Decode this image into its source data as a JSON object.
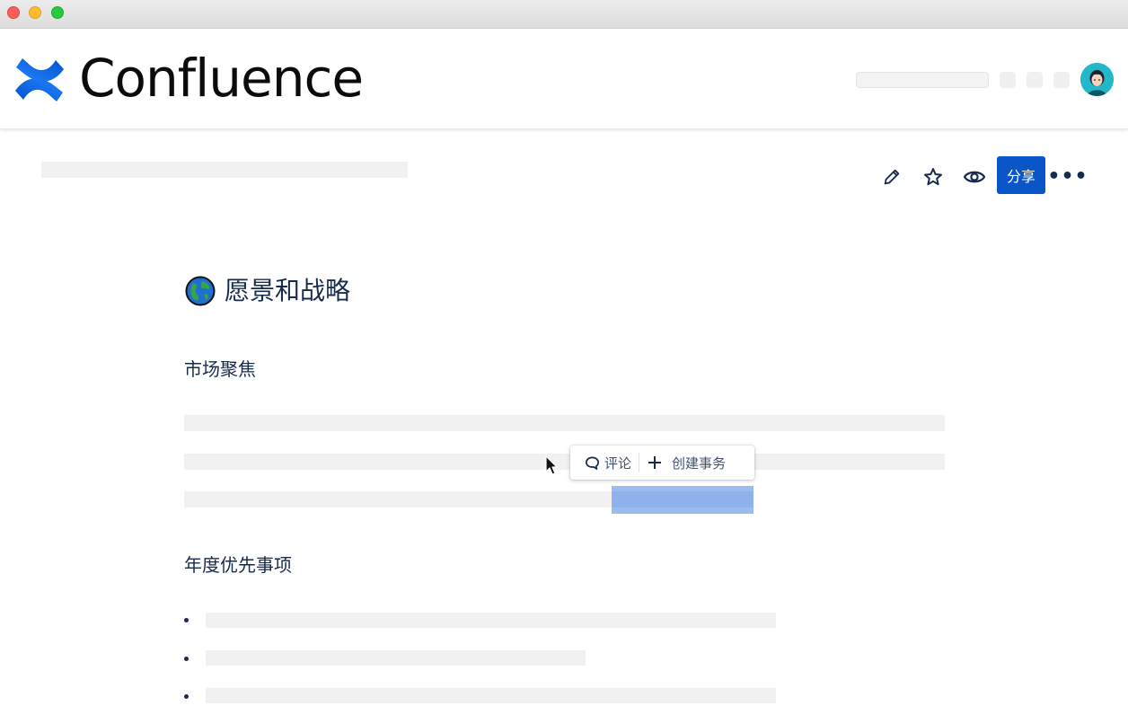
{
  "app": {
    "brand_name": "Confluence",
    "accent_color": "#0a55c7"
  },
  "header": {
    "search_placeholder": "",
    "avatar_color": "#1fb3c4"
  },
  "page_actions": {
    "edit_icon": "pencil-icon",
    "star_icon": "star-icon",
    "watch_icon": "eye-icon",
    "share_label": "分享",
    "more_label": "•••"
  },
  "page": {
    "title_emoji": "globe-icon",
    "title": "愿景和战略",
    "section1_heading": "市场聚焦",
    "section2_heading": "年度优先事项"
  },
  "inline_toolbar": {
    "comment_label": "评论",
    "create_issue_label": "创建事务"
  }
}
